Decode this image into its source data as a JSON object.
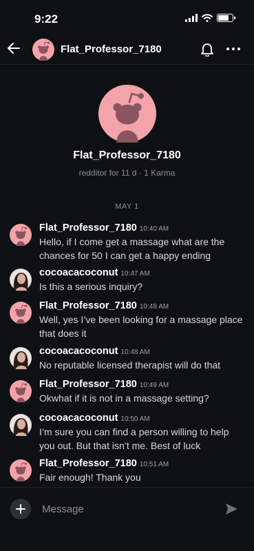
{
  "status_bar": {
    "time": "9:22",
    "battery_level": 0.85
  },
  "header": {
    "title": "Flat_Professor_7180"
  },
  "profile": {
    "username": "Flat_Professor_7180",
    "meta": "redditor for 11 d · 1 Karma"
  },
  "date_label": "MAY 1",
  "messages": [
    {
      "user": "Flat_Professor_7180",
      "time": "10:40 AM",
      "text": "Hello, if I come get a massage what are the chances for 50 I can get a happy ending",
      "avatar": "snoo-avatar"
    },
    {
      "user": "cocoacacoconut",
      "time": "10:47 AM",
      "text": "Is this a serious inquiry?",
      "avatar": "photo-avatar"
    },
    {
      "user": "Flat_Professor_7180",
      "time": "10:48 AM",
      "text": "Well, yes I’ve been looking for a massage place that does it",
      "avatar": "snoo-avatar"
    },
    {
      "user": "cocoacacoconut",
      "time": "10:48 AM",
      "text": "No reputable licensed therapist will do that",
      "avatar": "photo-avatar"
    },
    {
      "user": "Flat_Professor_7180",
      "time": "10:49 AM",
      "text": "Okwhat if it is not in a massage setting?",
      "avatar": "snoo-avatar"
    },
    {
      "user": "cocoacacoconut",
      "time": "10:50 AM",
      "text": "I’m sure you can find a person willing to help you out. But that isn’t me. Best of luck",
      "avatar": "photo-avatar"
    },
    {
      "user": "Flat_Professor_7180",
      "time": "10:51 AM",
      "text": "Fair enough! Thank you",
      "avatar": "snoo-avatar"
    }
  ],
  "composer": {
    "placeholder": "Message"
  },
  "colors": {
    "background": "#0e1113",
    "snoo_pink": "#f4a3aa",
    "snoo_dark": "#8a5561"
  }
}
